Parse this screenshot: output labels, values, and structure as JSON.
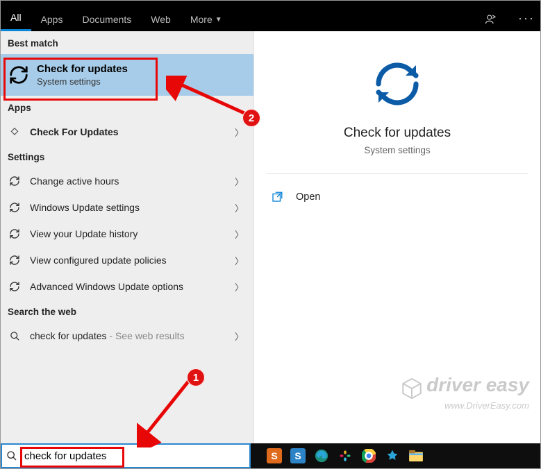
{
  "tabs": {
    "all": "All",
    "apps": "Apps",
    "documents": "Documents",
    "web": "Web",
    "more": "More"
  },
  "sections": {
    "best_match": "Best match",
    "apps": "Apps",
    "settings": "Settings",
    "search_web": "Search the web"
  },
  "best": {
    "title": "Check for updates",
    "subtitle": "System settings"
  },
  "apps_list": [
    {
      "label": "Check For Updates"
    }
  ],
  "settings_list": [
    {
      "label": "Change active hours"
    },
    {
      "label": "Windows Update settings"
    },
    {
      "label": "View your Update history"
    },
    {
      "label": "View configured update policies"
    },
    {
      "label": "Advanced Windows Update options"
    }
  ],
  "web": {
    "label": "check for updates",
    "suffix": " - See web results"
  },
  "preview": {
    "title": "Check for updates",
    "subtitle": "System settings",
    "open": "Open"
  },
  "search": {
    "value": "check for updates"
  },
  "annotations": {
    "one": "1",
    "two": "2"
  },
  "watermark": {
    "brand": "driver easy",
    "url": "www.DriverEasy.com"
  }
}
